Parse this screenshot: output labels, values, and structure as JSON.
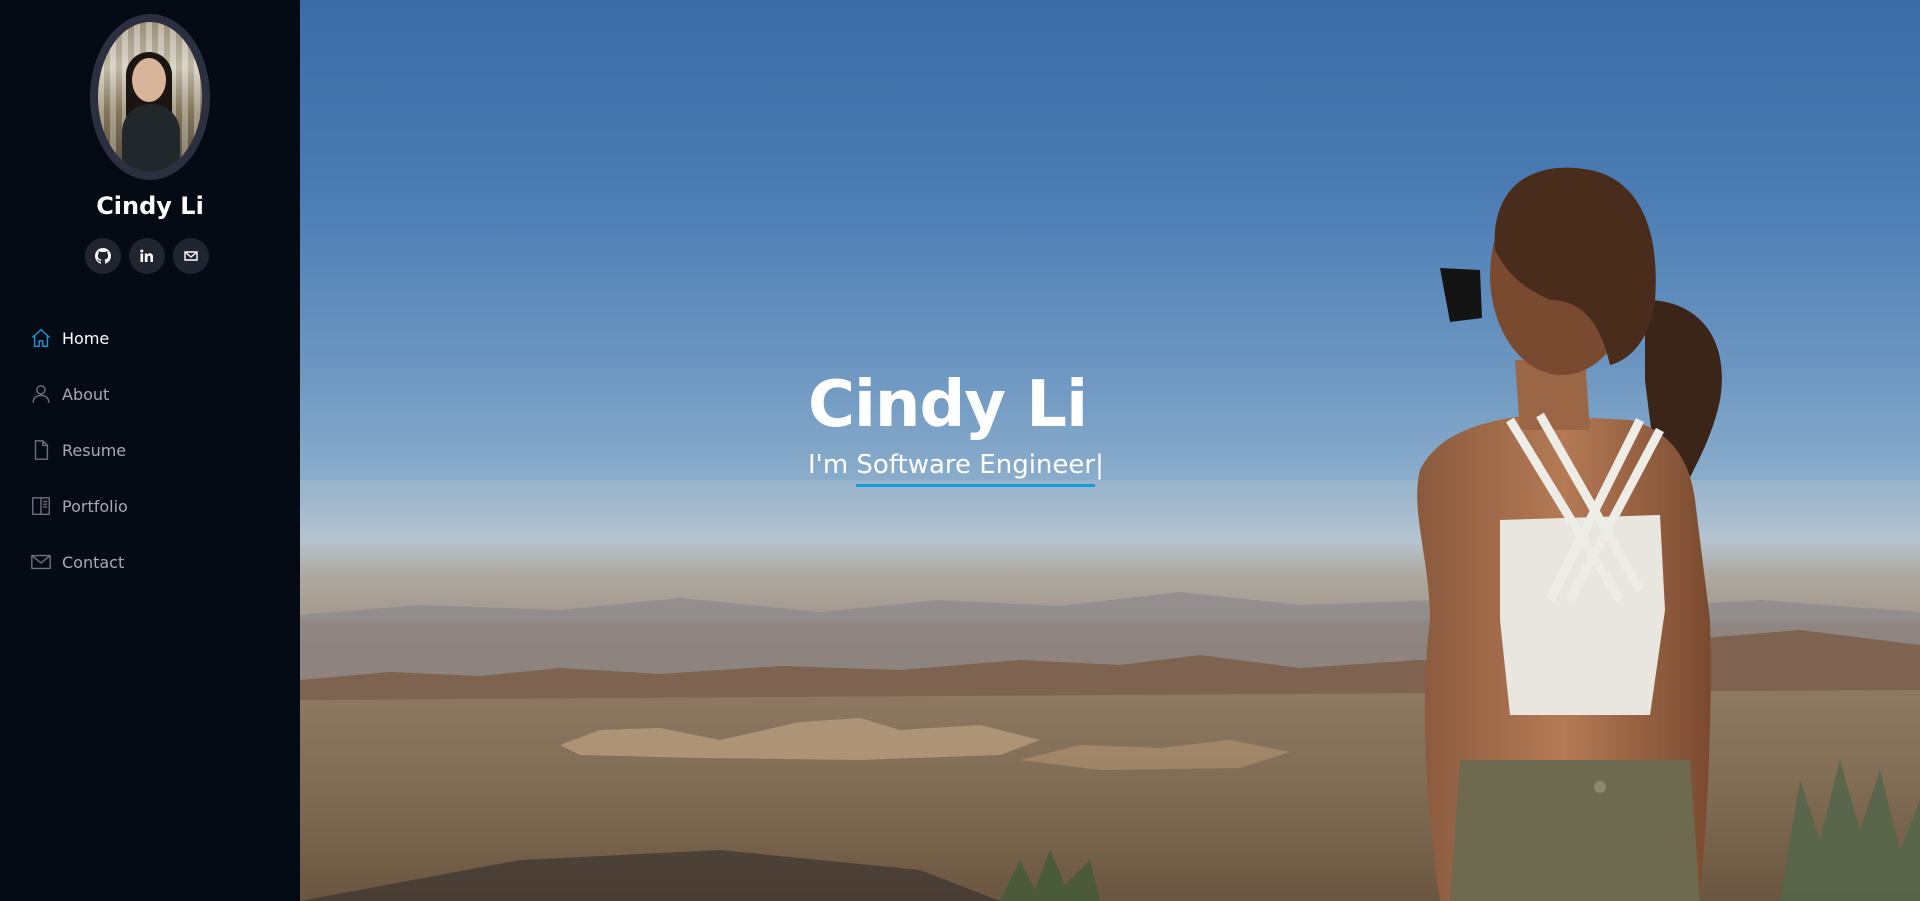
{
  "profile": {
    "name": "Cindy Li",
    "avatar_alt": "profile-photo"
  },
  "social": [
    {
      "name": "github-icon"
    },
    {
      "name": "linkedin-icon"
    },
    {
      "name": "email-icon"
    }
  ],
  "nav": {
    "items": [
      {
        "label": "Home",
        "icon": "home-icon",
        "active": true
      },
      {
        "label": "About",
        "icon": "person-icon",
        "active": false
      },
      {
        "label": "Resume",
        "icon": "file-icon",
        "active": false
      },
      {
        "label": "Portfolio",
        "icon": "book-icon",
        "active": false
      },
      {
        "label": "Contact",
        "icon": "envelope-icon",
        "active": false
      }
    ]
  },
  "hero": {
    "title": "Cindy Li",
    "prefix": "I'm ",
    "typed": "Software Engineer",
    "cursor": "|"
  },
  "colors": {
    "accent": "#149ddd",
    "sidebar_bg": "#040b14",
    "social_bg": "#212431",
    "nav_text": "#a8a9b4"
  }
}
